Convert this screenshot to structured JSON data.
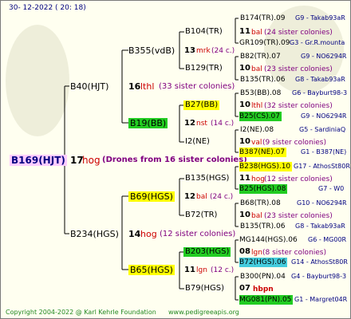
{
  "header": {
    "timestamp": "30-  12-2022  (  20:  18)"
  },
  "footer": {
    "copyright": "Copyright 2004-2022 @ Karl Kehrle Foundation",
    "website": "www.pedigreeapis.org"
  },
  "root": {
    "id": "B169(HJT)",
    "gen_num": "17",
    "gen_race": "hog",
    "note": "(Drones from 16 sister colonies)"
  },
  "g1": [
    {
      "id": "B40(HJT)",
      "num": "16",
      "race": "lthl",
      "note": "(33 sister colonies)"
    },
    {
      "id": "B234(HGS)",
      "num": "14",
      "race": "hog",
      "note": "(12 sister colonies)"
    }
  ],
  "g2": [
    {
      "id": "B355(vdB)",
      "num": "13",
      "race": "mrk",
      "note": "(24 c.)"
    },
    {
      "id": "B19(BB)",
      "num": "12",
      "race": "nst",
      "note": "(14 c.)"
    },
    {
      "id": "B69(HGS)",
      "num": "12",
      "race": "bal",
      "note": "(24 c.)"
    },
    {
      "id": "B65(HGS)",
      "num": "11",
      "race": "lgn",
      "note": "(12 c.)"
    }
  ],
  "g3": [
    {
      "id": "B104(TR)",
      "num": "11",
      "race": "bal",
      "note": "(24 sister colonies)"
    },
    {
      "id": "B129(TR)",
      "num": "10",
      "race": "bal",
      "note": "(23 sister colonies)"
    },
    {
      "id": "B27(BB)",
      "num": "10",
      "race": "lthl",
      "note": "(32 sister colonies)"
    },
    {
      "id": "I2(NE)",
      "num": "10",
      "race": "val",
      "note": "(9 sister colonies)"
    },
    {
      "id": "B135(HGS)",
      "num": "11",
      "race": "hog",
      "note": "(12 sister colonies)"
    },
    {
      "id": "B72(TR)",
      "num": "10",
      "race": "bal",
      "note": "(23 sister colonies)"
    },
    {
      "id": "B203(HGS)",
      "num": "08",
      "race": "lgn",
      "note": "(8 sister colonies)"
    },
    {
      "id": "B79(HGS)",
      "num": "07",
      "race": "hbpn",
      "note": ""
    }
  ],
  "g4": [
    {
      "id": "B174(TR).09",
      "info": "G9 - Takab93aR"
    },
    {
      "id": "GR109(TR).09",
      "info": "G3 - Gr.R.mounta"
    },
    {
      "id": "B82(TR).07",
      "info": "G9 - NO6294R"
    },
    {
      "id": "B135(TR).06",
      "info": "G8 - Takab93aR"
    },
    {
      "id": "B53(BB).08",
      "info": "G6 - Bayburt98-3"
    },
    {
      "id": "B25(CS).07",
      "info": "G9 - NO6294R"
    },
    {
      "id": "I2(NE).08",
      "info": "G5 - SardiniaQ"
    },
    {
      "id": "B387(NE).07",
      "info": "G1 - B387(NE)"
    },
    {
      "id": "B238(HGS).10",
      "info": "G17 - AthosSt80R"
    },
    {
      "id": "B25(HGS).08",
      "info": "G7 - W0"
    },
    {
      "id": "B68(TR).08",
      "info": "G10 - NO6294R"
    },
    {
      "id": "B135(TR).06",
      "info": "G8 - Takab93aR"
    },
    {
      "id": "MG144(HGS).06",
      "info": "G6 - MG00R"
    },
    {
      "id": "B72(HGS).06",
      "info": "G14 - AthosSt80R"
    },
    {
      "id": "B300(PN).04",
      "info": "G4 - Bayburt98-3"
    },
    {
      "id": "MG081(PN).05",
      "info": "G1 - Margret04R"
    }
  ]
}
